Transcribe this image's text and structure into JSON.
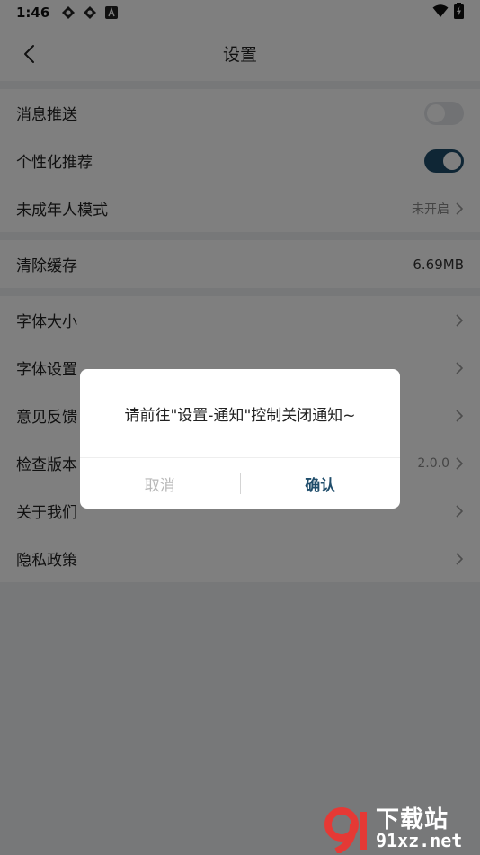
{
  "status_bar": {
    "time": "1:46",
    "notification_icons": [
      "sync-icon",
      "sync-icon",
      "a-icon"
    ],
    "wifi_icon": "wifi-icon",
    "battery_icon": "battery-charging-icon"
  },
  "header": {
    "title": "设置",
    "back_icon": "chevron-left-icon"
  },
  "settings": {
    "group1": [
      {
        "label": "消息推送",
        "type": "toggle",
        "on": false
      },
      {
        "label": "个性化推荐",
        "type": "toggle",
        "on": true
      },
      {
        "label": "未成年人模式",
        "type": "link",
        "value": "未开启"
      }
    ],
    "group2": [
      {
        "label": "清除缓存",
        "type": "value",
        "value": "6.69MB"
      }
    ],
    "group3": [
      {
        "label": "字体大小",
        "type": "link",
        "value": ""
      },
      {
        "label": "字体设置",
        "type": "link",
        "value": ""
      },
      {
        "label": "意见反馈",
        "type": "link",
        "value": ""
      },
      {
        "label": "检查版本",
        "type": "link",
        "value": "2.0.0"
      },
      {
        "label": "关于我们",
        "type": "link",
        "value": ""
      },
      {
        "label": "隐私政策",
        "type": "link",
        "value": ""
      }
    ]
  },
  "dialog": {
    "message": "请前往\"设置-通知\"控制关闭通知~",
    "cancel_label": "取消",
    "confirm_label": "确认"
  },
  "watermark": {
    "cn_text": "下载站",
    "url_text": "91xz.net"
  },
  "colors": {
    "accent": "#1f4d6b",
    "overlay": "rgba(0,0,0,0.5)"
  }
}
